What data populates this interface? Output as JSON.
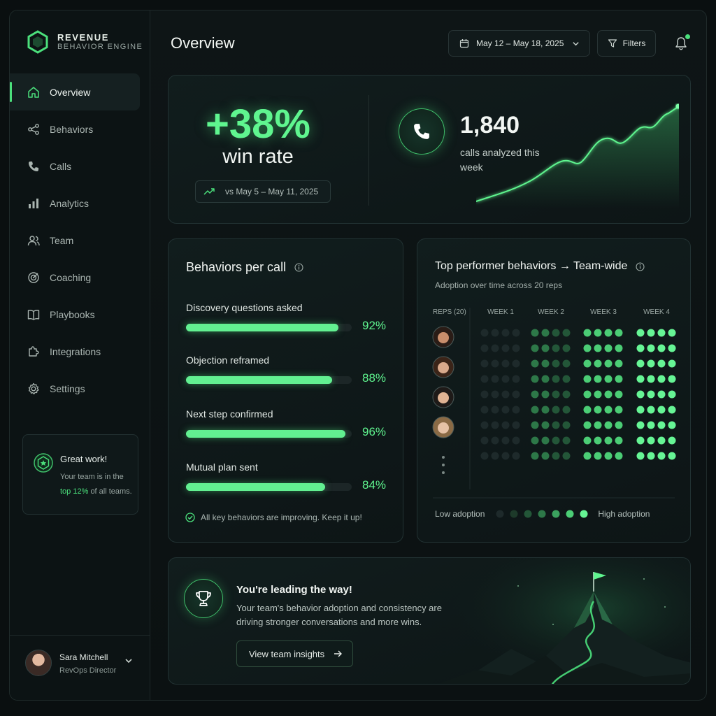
{
  "brand": {
    "line1": "REVENUE",
    "line2": "BEHAVIOR ENGINE"
  },
  "sidebar": {
    "items": [
      {
        "label": "Overview",
        "icon": "home-icon",
        "active": true
      },
      {
        "label": "Behaviors",
        "icon": "share-nodes-icon"
      },
      {
        "label": "Calls",
        "icon": "phone-icon"
      },
      {
        "label": "Analytics",
        "icon": "bar-chart-icon"
      },
      {
        "label": "Team",
        "icon": "users-icon"
      },
      {
        "label": "Coaching",
        "icon": "target-icon"
      },
      {
        "label": "Playbooks",
        "icon": "book-icon"
      },
      {
        "label": "Integrations",
        "icon": "puzzle-icon"
      },
      {
        "label": "Settings",
        "icon": "gear-icon"
      }
    ],
    "promo": {
      "title": "Great work!",
      "body_pre": "Your team is in the",
      "highlight": "top 12%",
      "body_post": "of all teams."
    },
    "user": {
      "name": "Sara Mitchell",
      "role": "RevOps Director"
    }
  },
  "header": {
    "title": "Overview",
    "date_range": "May 12 – May 18, 2025",
    "filters_label": "Filters"
  },
  "hero": {
    "win_rate_change": "+38%",
    "win_rate_label": "win rate",
    "comparison": "vs May 5 – May 11, 2025",
    "calls_count": "1,840",
    "calls_label": "calls analyzed this week"
  },
  "behaviors_card": {
    "title": "Behaviors per call",
    "metrics": [
      {
        "label": "Discovery questions asked",
        "value": "92%",
        "fraction": 0.92
      },
      {
        "label": "Objection reframed",
        "value": "88%",
        "fraction": 0.88
      },
      {
        "label": "Next step confirmed",
        "value": "96%",
        "fraction": 0.96
      },
      {
        "label": "Mutual plan sent",
        "value": "84%",
        "fraction": 0.84
      }
    ],
    "footer": "All key behaviors are improving. Keep it up!"
  },
  "top_performer": {
    "title": "Top performer behaviors → Team-wide",
    "subtitle": "Adoption over time across 20 reps",
    "reps_header": "REPS (20)",
    "weeks": [
      "WEEK 1",
      "WEEK 2",
      "WEEK 3",
      "WEEK 4"
    ],
    "legend_low": "Low adoption",
    "legend_high": "High adoption"
  },
  "leading": {
    "title": "You're leading the way!",
    "body": "Your team's behavior adoption and consistency are driving stronger conversations and more wins.",
    "button": "View team insights"
  },
  "colors": {
    "accent": "#4be07c",
    "background": "#0a0f10"
  }
}
